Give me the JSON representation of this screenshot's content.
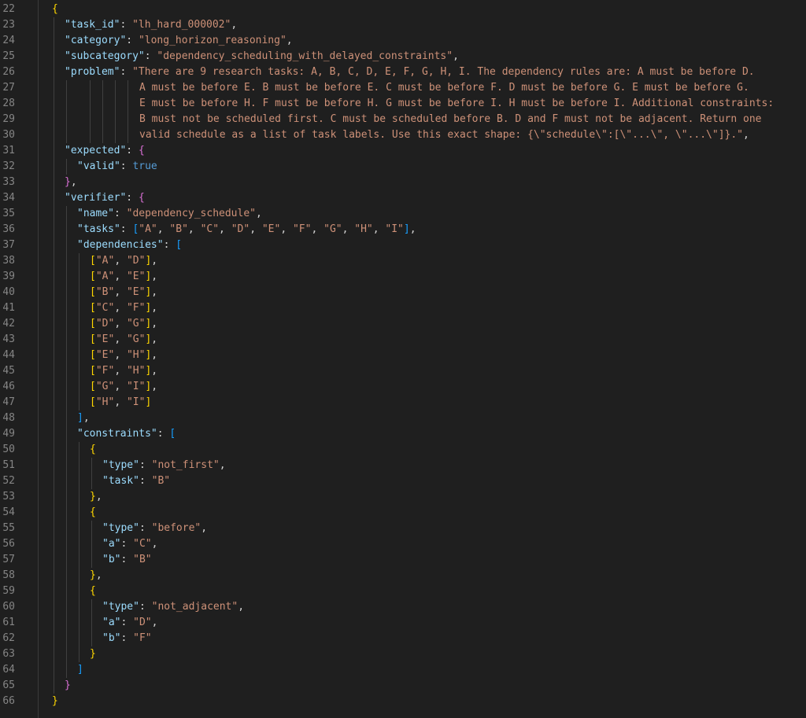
{
  "editor": {
    "lines": [
      {
        "num": "22",
        "indent": 0,
        "tokens": [
          [
            "b1",
            "{"
          ]
        ]
      },
      {
        "num": "23",
        "indent": 1,
        "tokens": [
          [
            "key",
            "\"task_id\""
          ],
          [
            "pun",
            ": "
          ],
          [
            "str",
            "\"lh_hard_000002\""
          ],
          [
            "pun",
            ","
          ]
        ]
      },
      {
        "num": "24",
        "indent": 1,
        "tokens": [
          [
            "key",
            "\"category\""
          ],
          [
            "pun",
            ": "
          ],
          [
            "str",
            "\"long_horizon_reasoning\""
          ],
          [
            "pun",
            ","
          ]
        ]
      },
      {
        "num": "25",
        "indent": 1,
        "tokens": [
          [
            "key",
            "\"subcategory\""
          ],
          [
            "pun",
            ": "
          ],
          [
            "str",
            "\"dependency_scheduling_with_delayed_constraints\""
          ],
          [
            "pun",
            ","
          ]
        ]
      },
      {
        "num": "26",
        "indent": 1,
        "tokens": [
          [
            "key",
            "\"problem\""
          ],
          [
            "pun",
            ": "
          ],
          [
            "str",
            "\"There are 9 research tasks: A, B, C, D, E, F, G, H, I. The dependency rules are: A must be before D."
          ]
        ]
      },
      {
        "num": "27",
        "indent": 1,
        "wrap": true,
        "tokens": [
          [
            "str",
            "A must be before E. B must be before E. C must be before F. D must be before G. E must be before G."
          ]
        ]
      },
      {
        "num": "28",
        "indent": 1,
        "wrap": true,
        "tokens": [
          [
            "str",
            "E must be before H. F must be before H. G must be before I. H must be before I. Additional constraints:"
          ]
        ]
      },
      {
        "num": "29",
        "indent": 1,
        "wrap": true,
        "tokens": [
          [
            "str",
            "B must not be scheduled first. C must be scheduled before B. D and F must not be adjacent. Return one"
          ]
        ]
      },
      {
        "num": "30",
        "indent": 1,
        "wrap": true,
        "tokens": [
          [
            "str",
            "valid schedule as a list of task labels. Use this exact shape: {\\\"schedule\\\":[\\\"...\\\", \\\"...\\\"]}.\""
          ],
          [
            "pun",
            ","
          ]
        ]
      },
      {
        "num": "31",
        "indent": 1,
        "tokens": [
          [
            "key",
            "\"expected\""
          ],
          [
            "pun",
            ": "
          ],
          [
            "b2",
            "{"
          ]
        ]
      },
      {
        "num": "32",
        "indent": 2,
        "tokens": [
          [
            "key",
            "\"valid\""
          ],
          [
            "pun",
            ": "
          ],
          [
            "bool",
            "true"
          ]
        ]
      },
      {
        "num": "33",
        "indent": 1,
        "tokens": [
          [
            "b2",
            "}"
          ],
          [
            "pun",
            ","
          ]
        ]
      },
      {
        "num": "34",
        "indent": 1,
        "tokens": [
          [
            "key",
            "\"verifier\""
          ],
          [
            "pun",
            ": "
          ],
          [
            "b2",
            "{"
          ]
        ]
      },
      {
        "num": "35",
        "indent": 2,
        "tokens": [
          [
            "key",
            "\"name\""
          ],
          [
            "pun",
            ": "
          ],
          [
            "str",
            "\"dependency_schedule\""
          ],
          [
            "pun",
            ","
          ]
        ]
      },
      {
        "num": "36",
        "indent": 2,
        "tokens": [
          [
            "key",
            "\"tasks\""
          ],
          [
            "pun",
            ": "
          ],
          [
            "b3",
            "["
          ],
          [
            "str",
            "\"A\""
          ],
          [
            "pun",
            ", "
          ],
          [
            "str",
            "\"B\""
          ],
          [
            "pun",
            ", "
          ],
          [
            "str",
            "\"C\""
          ],
          [
            "pun",
            ", "
          ],
          [
            "str",
            "\"D\""
          ],
          [
            "pun",
            ", "
          ],
          [
            "str",
            "\"E\""
          ],
          [
            "pun",
            ", "
          ],
          [
            "str",
            "\"F\""
          ],
          [
            "pun",
            ", "
          ],
          [
            "str",
            "\"G\""
          ],
          [
            "pun",
            ", "
          ],
          [
            "str",
            "\"H\""
          ],
          [
            "pun",
            ", "
          ],
          [
            "str",
            "\"I\""
          ],
          [
            "b3",
            "]"
          ],
          [
            "pun",
            ","
          ]
        ]
      },
      {
        "num": "37",
        "indent": 2,
        "tokens": [
          [
            "key",
            "\"dependencies\""
          ],
          [
            "pun",
            ": "
          ],
          [
            "b3",
            "["
          ]
        ]
      },
      {
        "num": "38",
        "indent": 3,
        "tokens": [
          [
            "b1",
            "["
          ],
          [
            "str",
            "\"A\""
          ],
          [
            "pun",
            ", "
          ],
          [
            "str",
            "\"D\""
          ],
          [
            "b1",
            "]"
          ],
          [
            "pun",
            ","
          ]
        ]
      },
      {
        "num": "39",
        "indent": 3,
        "tokens": [
          [
            "b1",
            "["
          ],
          [
            "str",
            "\"A\""
          ],
          [
            "pun",
            ", "
          ],
          [
            "str",
            "\"E\""
          ],
          [
            "b1",
            "]"
          ],
          [
            "pun",
            ","
          ]
        ]
      },
      {
        "num": "40",
        "indent": 3,
        "tokens": [
          [
            "b1",
            "["
          ],
          [
            "str",
            "\"B\""
          ],
          [
            "pun",
            ", "
          ],
          [
            "str",
            "\"E\""
          ],
          [
            "b1",
            "]"
          ],
          [
            "pun",
            ","
          ]
        ]
      },
      {
        "num": "41",
        "indent": 3,
        "tokens": [
          [
            "b1",
            "["
          ],
          [
            "str",
            "\"C\""
          ],
          [
            "pun",
            ", "
          ],
          [
            "str",
            "\"F\""
          ],
          [
            "b1",
            "]"
          ],
          [
            "pun",
            ","
          ]
        ]
      },
      {
        "num": "42",
        "indent": 3,
        "tokens": [
          [
            "b1",
            "["
          ],
          [
            "str",
            "\"D\""
          ],
          [
            "pun",
            ", "
          ],
          [
            "str",
            "\"G\""
          ],
          [
            "b1",
            "]"
          ],
          [
            "pun",
            ","
          ]
        ]
      },
      {
        "num": "43",
        "indent": 3,
        "tokens": [
          [
            "b1",
            "["
          ],
          [
            "str",
            "\"E\""
          ],
          [
            "pun",
            ", "
          ],
          [
            "str",
            "\"G\""
          ],
          [
            "b1",
            "]"
          ],
          [
            "pun",
            ","
          ]
        ]
      },
      {
        "num": "44",
        "indent": 3,
        "tokens": [
          [
            "b1",
            "["
          ],
          [
            "str",
            "\"E\""
          ],
          [
            "pun",
            ", "
          ],
          [
            "str",
            "\"H\""
          ],
          [
            "b1",
            "]"
          ],
          [
            "pun",
            ","
          ]
        ]
      },
      {
        "num": "45",
        "indent": 3,
        "tokens": [
          [
            "b1",
            "["
          ],
          [
            "str",
            "\"F\""
          ],
          [
            "pun",
            ", "
          ],
          [
            "str",
            "\"H\""
          ],
          [
            "b1",
            "]"
          ],
          [
            "pun",
            ","
          ]
        ]
      },
      {
        "num": "46",
        "indent": 3,
        "tokens": [
          [
            "b1",
            "["
          ],
          [
            "str",
            "\"G\""
          ],
          [
            "pun",
            ", "
          ],
          [
            "str",
            "\"I\""
          ],
          [
            "b1",
            "]"
          ],
          [
            "pun",
            ","
          ]
        ]
      },
      {
        "num": "47",
        "indent": 3,
        "tokens": [
          [
            "b1",
            "["
          ],
          [
            "str",
            "\"H\""
          ],
          [
            "pun",
            ", "
          ],
          [
            "str",
            "\"I\""
          ],
          [
            "b1",
            "]"
          ]
        ]
      },
      {
        "num": "48",
        "indent": 2,
        "tokens": [
          [
            "b3",
            "]"
          ],
          [
            "pun",
            ","
          ]
        ]
      },
      {
        "num": "49",
        "indent": 2,
        "tokens": [
          [
            "key",
            "\"constraints\""
          ],
          [
            "pun",
            ": "
          ],
          [
            "b3",
            "["
          ]
        ]
      },
      {
        "num": "50",
        "indent": 3,
        "tokens": [
          [
            "b1",
            "{"
          ]
        ]
      },
      {
        "num": "51",
        "indent": 4,
        "tokens": [
          [
            "key",
            "\"type\""
          ],
          [
            "pun",
            ": "
          ],
          [
            "str",
            "\"not_first\""
          ],
          [
            "pun",
            ","
          ]
        ]
      },
      {
        "num": "52",
        "indent": 4,
        "tokens": [
          [
            "key",
            "\"task\""
          ],
          [
            "pun",
            ": "
          ],
          [
            "str",
            "\"B\""
          ]
        ]
      },
      {
        "num": "53",
        "indent": 3,
        "tokens": [
          [
            "b1",
            "}"
          ],
          [
            "pun",
            ","
          ]
        ]
      },
      {
        "num": "54",
        "indent": 3,
        "tokens": [
          [
            "b1",
            "{"
          ]
        ]
      },
      {
        "num": "55",
        "indent": 4,
        "tokens": [
          [
            "key",
            "\"type\""
          ],
          [
            "pun",
            ": "
          ],
          [
            "str",
            "\"before\""
          ],
          [
            "pun",
            ","
          ]
        ]
      },
      {
        "num": "56",
        "indent": 4,
        "tokens": [
          [
            "key",
            "\"a\""
          ],
          [
            "pun",
            ": "
          ],
          [
            "str",
            "\"C\""
          ],
          [
            "pun",
            ","
          ]
        ]
      },
      {
        "num": "57",
        "indent": 4,
        "tokens": [
          [
            "key",
            "\"b\""
          ],
          [
            "pun",
            ": "
          ],
          [
            "str",
            "\"B\""
          ]
        ]
      },
      {
        "num": "58",
        "indent": 3,
        "tokens": [
          [
            "b1",
            "}"
          ],
          [
            "pun",
            ","
          ]
        ]
      },
      {
        "num": "59",
        "indent": 3,
        "tokens": [
          [
            "b1",
            "{"
          ]
        ]
      },
      {
        "num": "60",
        "indent": 4,
        "tokens": [
          [
            "key",
            "\"type\""
          ],
          [
            "pun",
            ": "
          ],
          [
            "str",
            "\"not_adjacent\""
          ],
          [
            "pun",
            ","
          ]
        ]
      },
      {
        "num": "61",
        "indent": 4,
        "tokens": [
          [
            "key",
            "\"a\""
          ],
          [
            "pun",
            ": "
          ],
          [
            "str",
            "\"D\""
          ],
          [
            "pun",
            ","
          ]
        ]
      },
      {
        "num": "62",
        "indent": 4,
        "tokens": [
          [
            "key",
            "\"b\""
          ],
          [
            "pun",
            ": "
          ],
          [
            "str",
            "\"F\""
          ]
        ]
      },
      {
        "num": "63",
        "indent": 3,
        "tokens": [
          [
            "b1",
            "}"
          ]
        ]
      },
      {
        "num": "64",
        "indent": 2,
        "tokens": [
          [
            "b3",
            "]"
          ]
        ]
      },
      {
        "num": "65",
        "indent": 1,
        "tokens": [
          [
            "b2",
            "}"
          ]
        ]
      },
      {
        "num": "66",
        "indent": 0,
        "tokens": [
          [
            "b1",
            "}"
          ]
        ]
      }
    ]
  },
  "colors": {
    "background": "#1f1f1f",
    "line_number": "#858585",
    "key": "#9cdcfe",
    "string": "#ce9178",
    "punctuation": "#d4d4d4",
    "boolean": "#569cd6",
    "bracket_level_1": "#ffd700",
    "bracket_level_2": "#da70d6",
    "bracket_level_3": "#179fff"
  }
}
